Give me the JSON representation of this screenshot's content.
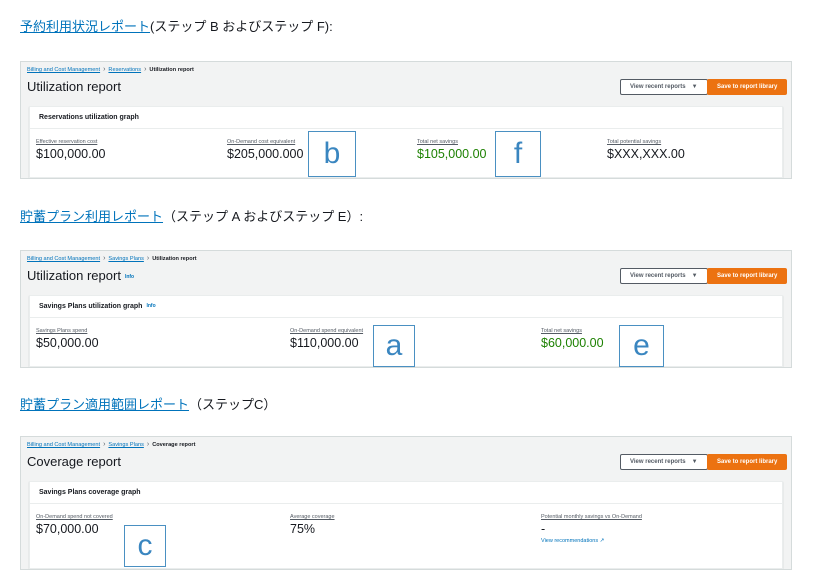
{
  "heading_ri": {
    "link": "予約利用状況レポート",
    "suffix": "(ステップ B およびステップ F):"
  },
  "heading_sp_util": {
    "link": "貯蓄プラン利用レポート",
    "suffix": "（ステップ A およびステップ E）:"
  },
  "heading_sp_cov": {
    "link": "貯蓄プラン適用範囲レポート",
    "suffix": "（ステップC）"
  },
  "panel_ri": {
    "breadcrumb": [
      "Billing and Cost Management",
      "Reservations",
      "Utilization report"
    ],
    "title": "Utilization report",
    "recent_button": "View recent reports",
    "save_button": "Save to report library",
    "graph_title": "Reservations utilization graph",
    "metrics": [
      {
        "label": "Effective reservation cost",
        "value": "$100,000.00"
      },
      {
        "label": "On-Demand cost equivalent",
        "value": "$205,000.000"
      },
      {
        "label": "Total net savings",
        "value": "$105,000.00"
      },
      {
        "label": "Total potential savings",
        "value": "$XXX,XXX.00"
      }
    ],
    "step_labels": [
      "b",
      "f"
    ]
  },
  "panel_sp_util": {
    "breadcrumb": [
      "Billing and Cost Management",
      "Savings Plans",
      "Utilization report"
    ],
    "title": "Utilization report",
    "info": "Info",
    "recent_button": "View recent reports",
    "save_button": "Save to report library",
    "graph_title": "Savings Plans utilization graph",
    "graph_info": "Info",
    "metrics": [
      {
        "label": "Savings Plans spend",
        "value": "$50,000.00"
      },
      {
        "label": "On-Demand spend equivalent",
        "value": "$110,000.00"
      },
      {
        "label": "Total net savings",
        "value": "$60,000.00"
      }
    ],
    "step_labels": [
      "a",
      "e"
    ]
  },
  "panel_sp_cov": {
    "breadcrumb": [
      "Billing and Cost Management",
      "Savings Plans",
      "Coverage report"
    ],
    "title": "Coverage report",
    "recent_button": "View recent reports",
    "save_button": "Save to report library",
    "graph_title": "Savings Plans coverage graph",
    "metrics": [
      {
        "label": "On-Demand spend not covered",
        "value": "$70,000.00"
      },
      {
        "label": "Average coverage",
        "value": "75%"
      },
      {
        "label": "Potential monthly savings vs On-Demand",
        "value": "-",
        "link": "View recommendations"
      }
    ],
    "step_labels": [
      "c"
    ]
  },
  "icons": {
    "dropdown": "caret-down-icon",
    "external": "external-link-icon"
  },
  "colors": {
    "link": "#0073bb",
    "primary_button": "#ec7211",
    "savings_green": "#1d8102",
    "step_box": "#4a90c2"
  }
}
